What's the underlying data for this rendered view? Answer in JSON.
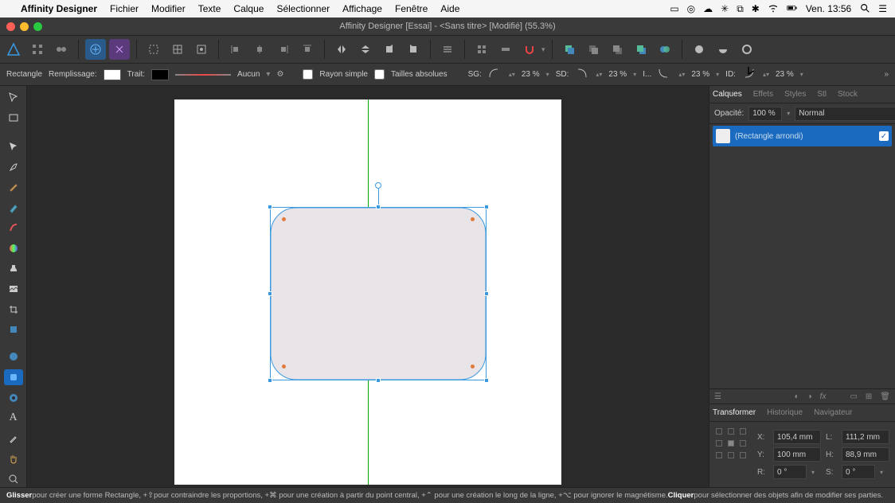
{
  "menubar": {
    "app": "Affinity Designer",
    "items": [
      "Fichier",
      "Modifier",
      "Texte",
      "Calque",
      "Sélectionner",
      "Affichage",
      "Fenêtre",
      "Aide"
    ],
    "clock": "Ven. 13:56"
  },
  "window": {
    "title": "Affinity Designer [Essai] - <Sans titre> [Modifié] (55.3%)",
    "traffic": {
      "close": "#ff5f57",
      "min": "#febc2e",
      "max": "#28c840"
    }
  },
  "contextbar": {
    "shape": "Rectangle",
    "fill_label": "Remplissage:",
    "fill_color": "#ffffff",
    "stroke_label": "Trait:",
    "stroke_color": "#000000",
    "stroke_value": "Aucun",
    "single_radius": "Rayon simple",
    "absolute_sizes": "Tailles absolues",
    "corners": {
      "sg_label": "SG:",
      "sg_value": "23 %",
      "sd_label": "SD:",
      "sd_value": "23 %",
      "i_label": "I...",
      "i_value": "23 %",
      "id_label": "ID:",
      "id_value": "23 %"
    }
  },
  "panels": {
    "top_tabs": [
      "Calques",
      "Effets",
      "Styles",
      "Stl",
      "Stock"
    ],
    "opacity_label": "Opacité:",
    "opacity_value": "100 %",
    "blend_mode": "Normal",
    "layer_name": "(Rectangle arrondi)",
    "bottom_tabs": [
      "Transformer",
      "Historique",
      "Navigateur"
    ],
    "transform": {
      "x_label": "X:",
      "x": "105,4 mm",
      "l_label": "L:",
      "l": "111,2 mm",
      "y_label": "Y:",
      "y": "100 mm",
      "h_label": "H:",
      "h": "88,9 mm",
      "r_label": "R:",
      "r": "0 °",
      "s_label": "S:",
      "s": "0 °"
    }
  },
  "statusbar": {
    "t1": "Glisser",
    "t2": " pour créer une forme Rectangle, +⇧ ",
    "t3": " pour contraindre les proportions, +⌘ pour une création à partir du point central, +⌃ pour une création le long de la ligne, +⌥ pour ignorer le magnétisme. ",
    "t4": "Cliquer",
    "t5": " pour sélectionner des objets afin de modifier ses parties."
  }
}
